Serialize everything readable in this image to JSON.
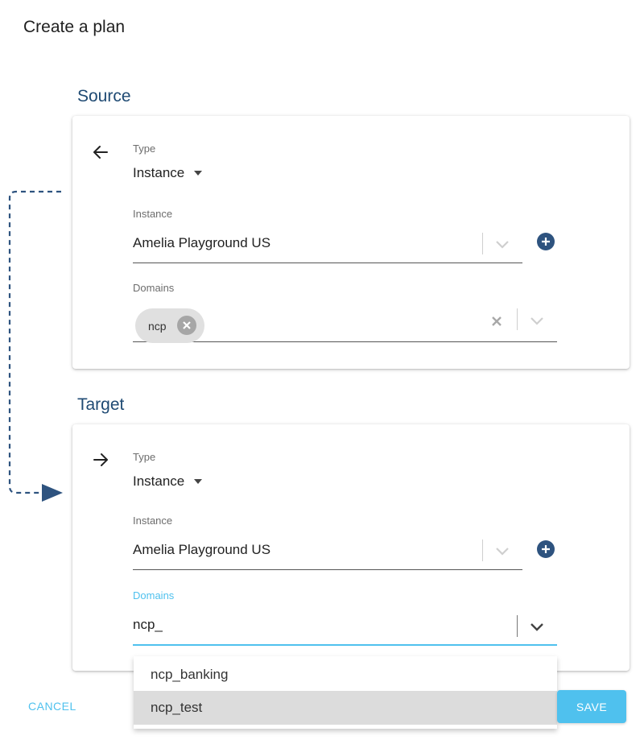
{
  "page": {
    "title": "Create a plan"
  },
  "source": {
    "section_title": "Source",
    "direction_icon": "arrow-left-icon",
    "type_label": "Type",
    "type_value": "Instance",
    "instance_label": "Instance",
    "instance_value": "Amelia Playground US",
    "domains_label": "Domains",
    "domain_chips": [
      "ncp"
    ]
  },
  "target": {
    "section_title": "Target",
    "direction_icon": "arrow-right-icon",
    "type_label": "Type",
    "type_value": "Instance",
    "instance_label": "Instance",
    "instance_value": "Amelia Playground US",
    "domains_label": "Domains",
    "domains_input_value": "ncp_"
  },
  "dropdown": {
    "options": [
      "ncp_banking",
      "ncp_test"
    ],
    "highlighted_option": "ncp_test"
  },
  "actions": {
    "cancel_label": "CANCEL",
    "save_label": "SAVE"
  },
  "colors": {
    "heading": "#1f4a73",
    "accent": "#4fc1ee",
    "plus_button": "#2e537f",
    "connector": "#2e537f"
  }
}
